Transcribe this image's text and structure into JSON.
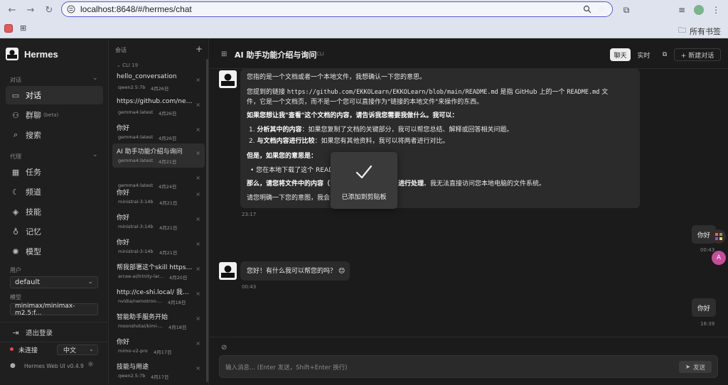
{
  "browser": {
    "url": "localhost:8648/#/hermes/chat",
    "bookmarks_label": "所有书签"
  },
  "app": {
    "brand": "Hermes",
    "sections": {
      "chat": "对话",
      "agent": "代理",
      "user": "用户",
      "model": "模型"
    },
    "nav": {
      "chat": "对话",
      "group": "群聊",
      "group_badge": "(beta)",
      "search": "搜索",
      "tasks": "任务",
      "channels": "频道",
      "skills": "技能",
      "memory": "记忆",
      "models": "模型"
    },
    "user_select": "default",
    "model_select": "minimax/minimax-m2.5:f...",
    "logout": "退出登录",
    "status": "未连接",
    "language": "中文",
    "version": "Hermes Web UI v0.4.9",
    "colors": {
      "status_dot": "#e5484d",
      "accent_border": "#5c5ad0"
    }
  },
  "conversations": {
    "header": "会话",
    "add": "+",
    "group": "CLI 19",
    "items": [
      {
        "title": "hello_conversation",
        "model": "qwen2.5:7b",
        "date": "4月26日"
      },
      {
        "title": "https://github.com/nesque...",
        "model": "gemma4:latest",
        "date": "4月26日"
      },
      {
        "title": "你好",
        "model": "gemma4:latest",
        "date": "4月26日"
      },
      {
        "title": "AI 助手功能介绍与询问",
        "model": "gemma4:latest",
        "date": "4月21日"
      },
      {
        "title": "",
        "model": "gemma4:latest",
        "date": "4月24日"
      },
      {
        "title": "你好",
        "model": "ministral-3:14b",
        "date": "4月21日"
      },
      {
        "title": "你好",
        "model": "ministral-3:14b",
        "date": "4月21日"
      },
      {
        "title": "你好",
        "model": "ministral-3:14b",
        "date": "4月21日"
      },
      {
        "title": "帮我部署这个skill https://gi...",
        "model": "arcee-ai/trinity-lar...",
        "date": "4月20日"
      },
      {
        "title": "http://ce-shi.local/ 我打开...",
        "model": "nvidia/nemotron-...",
        "date": "4月18日"
      },
      {
        "title": "智能助手服务开始",
        "model": "moonshotai/kimi-...",
        "date": "4月18日"
      },
      {
        "title": "你好",
        "model": "mimo-v2-pro",
        "date": "4月17日"
      },
      {
        "title": "技能与用途",
        "model": "qwen2.5:7b",
        "date": "4月17日"
      }
    ]
  },
  "chat": {
    "title": "AI 助手功能介绍与询问",
    "tag": "CLI",
    "btn_chat": "聊天",
    "btn_live": "实时",
    "btn_new": "+ 新建对话",
    "msg1": {
      "l1": "您指的是一个文档或者一个本地文件，我想确认一下您的意思。",
      "l2a": "您提到的链接 ",
      "l2_code": "https://github.com/EKKOLearn/EKKOLearn/blob/main/README.md",
      "l2b": " 是指 GitHub 上的一个 ",
      "l2_code2": "README.md",
      "l2c": " 文",
      "l3": "件，它是一个文档页，而不是一个您可以直接作为\"链接的本地文件\"来操作的东西。",
      "l4": "如果您想让我\"查看\"这个文档的内容，请告诉我您需要我做什么。我可以：",
      "l5_b": "分析其中的内容",
      "l5": "：如果您复制了文档的关键部分，我可以帮您总结、解释或回答相关问题。",
      "l6_b": "与文档内容进行比较",
      "l6": "：如果您有其他资料，我可以将两者进行对比。",
      "l7": "但是，如果您的意思是：",
      "l8": "您在本地下载了这个 README",
      "l9_a": "那么，请您将文件中的内容（",
      "l9_b": "进行处理",
      "l9_c": "。我无法直接访问您本地电脑的文件系统。",
      "l10": "请您明确一下您的意图，我会",
      "time": "23:17"
    },
    "user1": {
      "text": "你好",
      "time": "00:43"
    },
    "msg2": {
      "text": "您好！有什么我可以帮您的吗？ 😊",
      "time": "00:43"
    },
    "user2": {
      "text": "你好",
      "time": "16:39"
    },
    "toast": "已添加到剪贴板",
    "input_placeholder": "输入消息... (Enter 发送，Shift+Enter 换行)",
    "send": "发送"
  }
}
